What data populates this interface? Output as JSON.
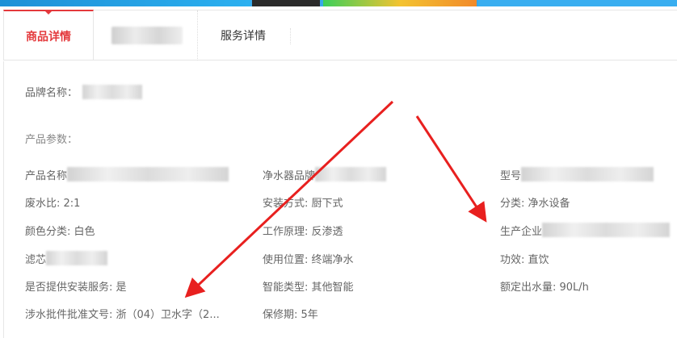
{
  "tabs": [
    {
      "label": "商品详情",
      "active": true
    },
    {
      "label": "",
      "active": false
    },
    {
      "label": "服务详情",
      "active": false
    }
  ],
  "brand": {
    "label": "品牌名称："
  },
  "params_title": "产品参数：",
  "params": {
    "col1": [
      {
        "label": "产品名称",
        "value": ""
      },
      {
        "label": "废水比: 2:1",
        "value": ""
      },
      {
        "label": "颜色分类: 白色",
        "value": ""
      },
      {
        "label": "滤芯",
        "value": ""
      },
      {
        "label": "是否提供安装服务: 是",
        "value": ""
      },
      {
        "label": "涉水批件批准文号: 浙（04）卫水字（2...",
        "value": ""
      }
    ],
    "col2": [
      {
        "label": "净水器品牌",
        "value": ""
      },
      {
        "label": "安装方式: 厨下式",
        "value": ""
      },
      {
        "label": "工作原理: 反渗透",
        "value": ""
      },
      {
        "label": "使用位置: 终端净水",
        "value": ""
      },
      {
        "label": "智能类型: 其他智能",
        "value": ""
      },
      {
        "label": "保修期: 5年",
        "value": ""
      }
    ],
    "col3": [
      {
        "label": "型号",
        "value": ""
      },
      {
        "label": "分类: 净水设备",
        "value": ""
      },
      {
        "label": "生产企业",
        "value": ""
      },
      {
        "label": "功效: 直饮",
        "value": ""
      },
      {
        "label": "额定出水量: 90L/h",
        "value": ""
      }
    ]
  },
  "colors": {
    "accent": "#e4393c",
    "annotation": "#e8201f"
  }
}
